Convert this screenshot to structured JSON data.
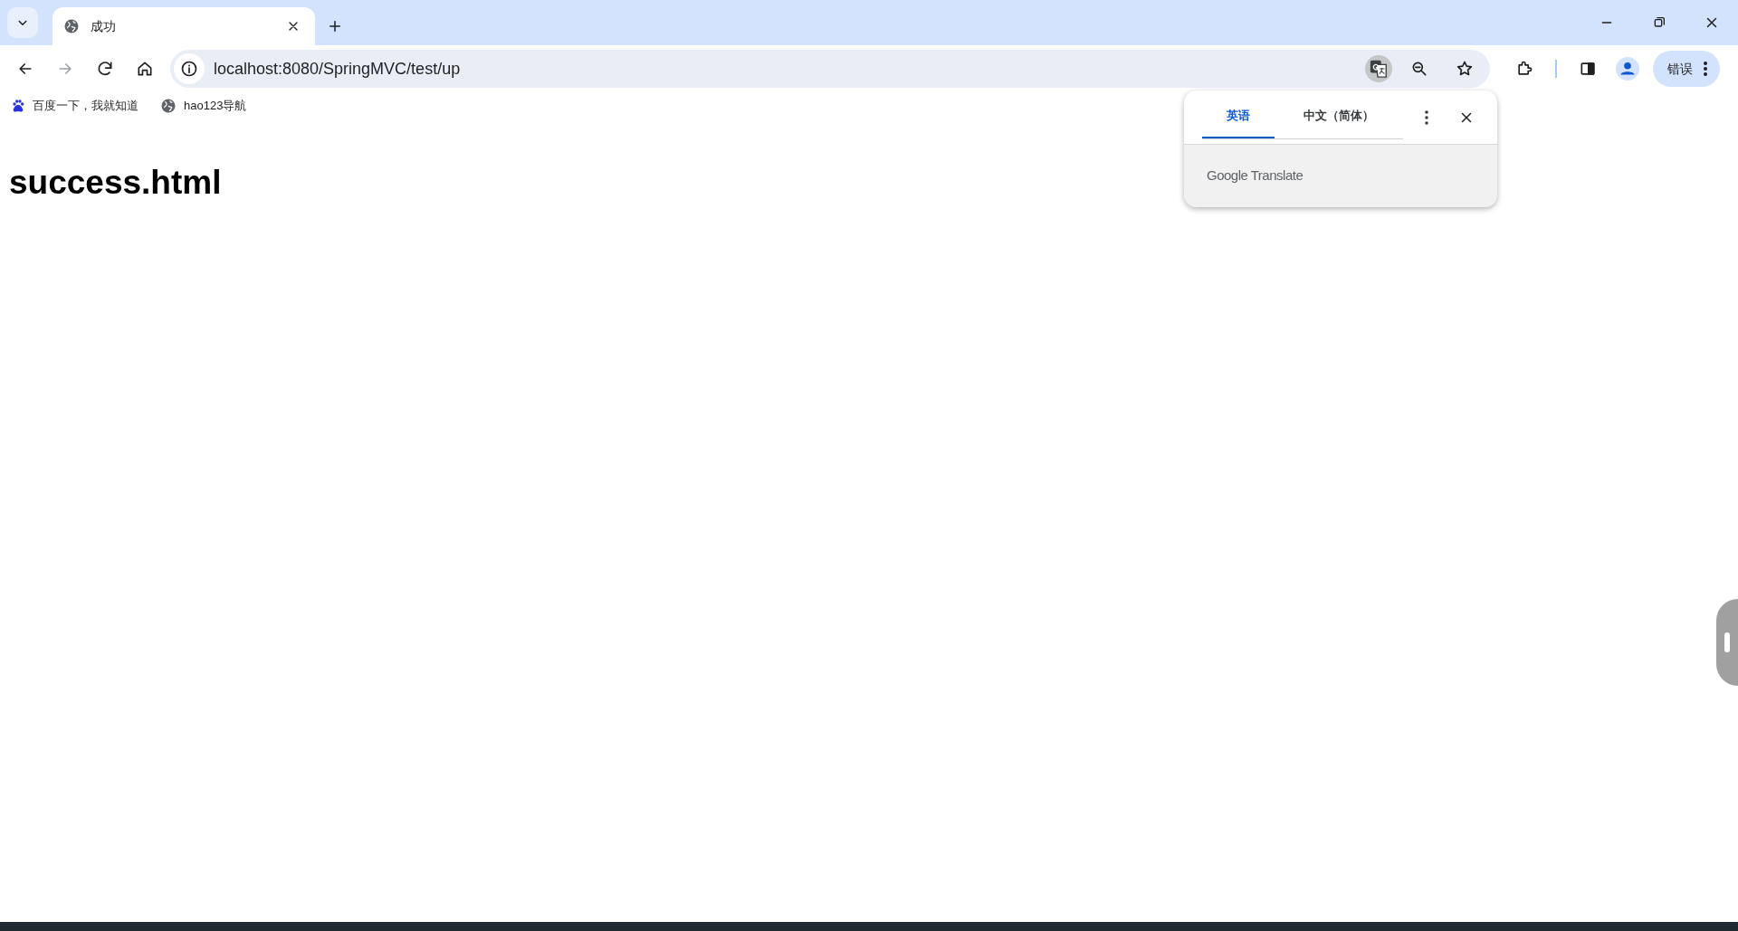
{
  "browser": {
    "tabs": [
      {
        "title": "成功",
        "selected": true
      }
    ],
    "address": "localhost:8080/SpringMVC/test/up",
    "profile_button": "错误"
  },
  "bookmarks": [
    {
      "label": "百度一下，我就知道",
      "kind": "paw"
    },
    {
      "label": "hao123导航",
      "kind": "globe"
    }
  ],
  "page": {
    "heading": "success.html"
  },
  "translate_popup": {
    "tabs": [
      {
        "label": "英语",
        "selected": true
      },
      {
        "label": "中文（简体）",
        "selected": false
      }
    ],
    "footer": "Google Translate"
  }
}
